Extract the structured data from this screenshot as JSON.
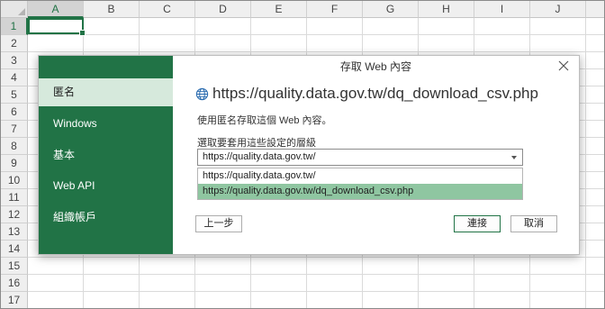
{
  "sheet": {
    "columns": [
      "A",
      "B",
      "C",
      "D",
      "E",
      "F",
      "G",
      "H",
      "I",
      "J"
    ],
    "rows": [
      "1",
      "2",
      "3",
      "4",
      "5",
      "6",
      "7",
      "8",
      "9",
      "10",
      "11",
      "12",
      "13",
      "14",
      "15",
      "16",
      "17"
    ]
  },
  "dialog": {
    "title": "存取 Web 內容",
    "url": "https://quality.data.gov.tw/dq_download_csv.php",
    "description": "使用匿名存取這個 Web 內容。",
    "select_label": "選取要套用這些設定的層級",
    "select_value": "https://quality.data.gov.tw/",
    "options": [
      "https://quality.data.gov.tw/",
      "https://quality.data.gov.tw/dq_download_csv.php"
    ],
    "sidebar": [
      "匿名",
      "Windows",
      "基本",
      "Web API",
      "組織帳戶"
    ],
    "buttons": {
      "back": "上一步",
      "connect": "連接",
      "cancel": "取消"
    }
  },
  "colors": {
    "accent": "#217346",
    "sidebar_active": "#d6e9dc",
    "option_highlight": "#8fc6a1"
  },
  "icons": {
    "globe": "globe-icon",
    "close": "close-icon",
    "dropdown": "chevron-down-icon"
  }
}
